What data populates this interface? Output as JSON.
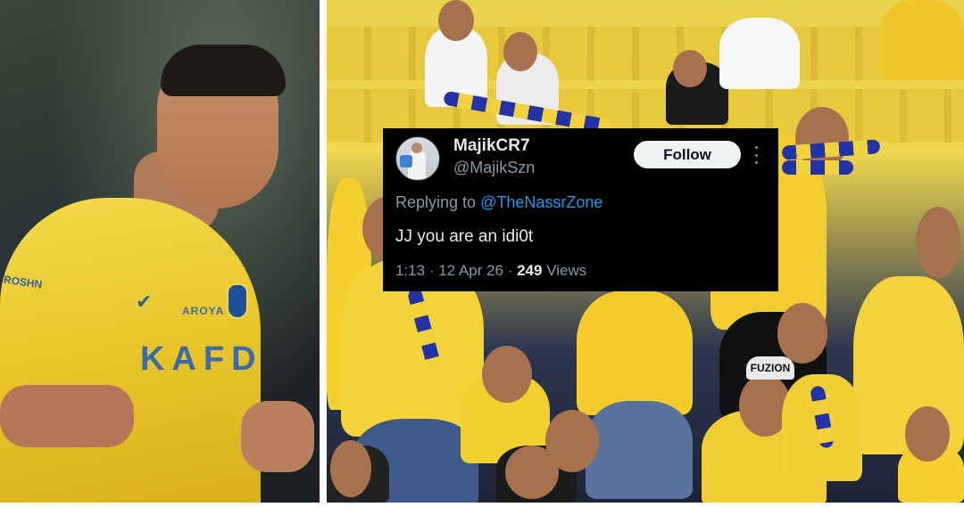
{
  "tweet": {
    "display_name": "MajikCR7",
    "handle": "@MajikSzn",
    "follow_label": "Follow",
    "reply_prefix": "Replying to ",
    "reply_mention": "@TheNassrZone",
    "text": "JJ you are an idi0t",
    "time": "1:13",
    "separator1": " · ",
    "date": "12 Apr 26",
    "separator2": " · ",
    "views_count": "249",
    "views_label": " Views"
  },
  "photo_left": {
    "kit_sponsor": "KAFD",
    "kit_brand": "AROYA",
    "sleeve_text": "ROSHN"
  },
  "photo_right": {
    "cap_text": "FUZION"
  },
  "colors": {
    "card_bg": "#000000",
    "link_blue": "#1d9bf0",
    "muted_text": "#8b98a5",
    "kit_yellow": "#f3d94a",
    "kit_blue": "#2f5fa3"
  },
  "icons": {
    "more": "more-icon"
  }
}
